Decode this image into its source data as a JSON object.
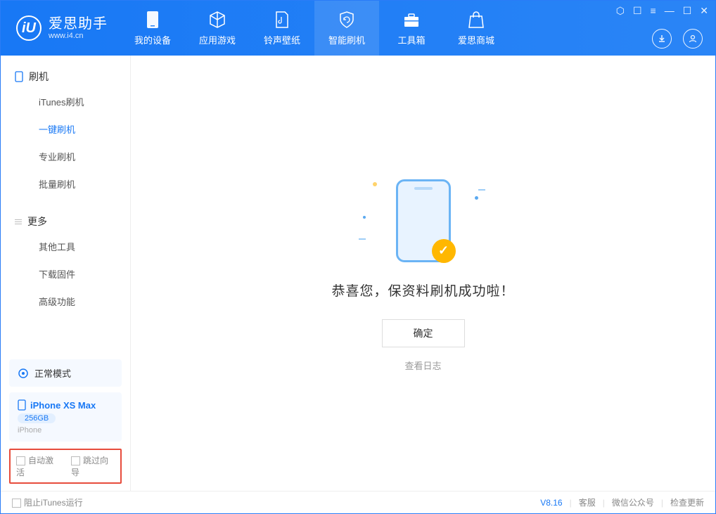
{
  "header": {
    "logo_letter": "iU",
    "app_name": "爱思助手",
    "app_url": "www.i4.cn",
    "nav": [
      {
        "label": "我的设备"
      },
      {
        "label": "应用游戏"
      },
      {
        "label": "铃声壁纸"
      },
      {
        "label": "智能刷机"
      },
      {
        "label": "工具箱"
      },
      {
        "label": "爱思商城"
      }
    ]
  },
  "sidebar": {
    "group1_title": "刷机",
    "group1_items": [
      {
        "label": "iTunes刷机"
      },
      {
        "label": "一键刷机"
      },
      {
        "label": "专业刷机"
      },
      {
        "label": "批量刷机"
      }
    ],
    "group2_title": "更多",
    "group2_items": [
      {
        "label": "其他工具"
      },
      {
        "label": "下载固件"
      },
      {
        "label": "高级功能"
      }
    ],
    "mode_label": "正常模式",
    "device_name": "iPhone XS Max",
    "device_capacity": "256GB",
    "device_type": "iPhone",
    "cb1": "自动激活",
    "cb2": "跳过向导"
  },
  "main": {
    "success_text": "恭喜您，保资料刷机成功啦！",
    "confirm": "确定",
    "log_link": "查看日志"
  },
  "footer": {
    "block_itunes": "阻止iTunes运行",
    "version": "V8.16",
    "link1": "客服",
    "link2": "微信公众号",
    "link3": "检查更新"
  }
}
